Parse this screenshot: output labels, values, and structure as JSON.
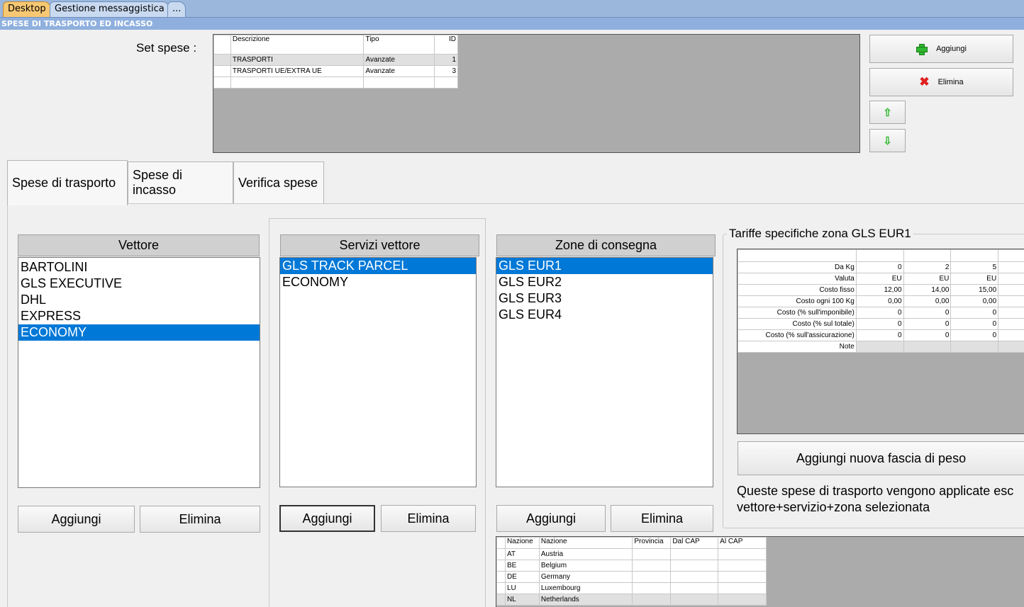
{
  "top_tabs": [
    "Desktop",
    "Gestione messaggistica",
    "..."
  ],
  "section_title": "SPESE DI TRASPORTO ED INCASSO",
  "set_spese": {
    "label": "Set spese :",
    "columns": [
      "Descrizione",
      "Tipo",
      "ID"
    ],
    "rows": [
      {
        "descrizione": "TRASPORTI",
        "tipo": "Avanzate",
        "id": "1"
      },
      {
        "descrizione": "TRASPORTI UE/EXTRA UE",
        "tipo": "Avanzate",
        "id": "3"
      }
    ],
    "add_label": "Aggiungi",
    "delete_label": "Elimina",
    "up_icon": "arrow-up-icon",
    "down_icon": "arrow-down-icon"
  },
  "tabs": [
    "Spese di trasporto",
    "Spese di incasso",
    "Verifica spese"
  ],
  "vettore": {
    "header": "Vettore",
    "items": [
      "BARTOLINI",
      "GLS EXECUTIVE",
      "DHL",
      "EXPRESS",
      "ECONOMY"
    ],
    "selected": "ECONOMY",
    "add_label": "Aggiungi",
    "delete_label": "Elimina"
  },
  "servizi": {
    "header": "Servizi vettore",
    "items": [
      "GLS TRACK PARCEL",
      "ECONOMY"
    ],
    "selected": "GLS TRACK PARCEL",
    "add_label": "Aggiungi",
    "delete_label": "Elimina"
  },
  "zone": {
    "header": "Zone di consegna",
    "items": [
      "GLS EUR1",
      "GLS EUR2",
      "GLS EUR3",
      "GLS EUR4"
    ],
    "selected": "GLS EUR1",
    "add_label": "Aggiungi",
    "delete_label": "Elimina",
    "nazioni_columns": [
      "Nazione",
      "Nazione",
      "Provincia",
      "Dal CAP",
      "Al CAP"
    ],
    "nazioni_rows": [
      [
        "AT",
        "Austria"
      ],
      [
        "BE",
        "Belgium"
      ],
      [
        "DE",
        "Germany"
      ],
      [
        "LU",
        "Luxembourg"
      ],
      [
        "NL",
        "Netherlands"
      ]
    ]
  },
  "tariffe": {
    "title": "Tariffe specifiche zona GLS EUR1",
    "row_labels": [
      "Da Kg",
      "Valuta",
      "Costo fisso",
      "Costo ogni 100 Kg",
      "Costo (% sull'imponibile)",
      "Costo (% sul totale)",
      "Costo (% sull'assicurazione)",
      "Note"
    ],
    "columns": [
      [
        "0",
        "EU",
        "12,00",
        "0,00",
        "0",
        "0",
        "0",
        ""
      ],
      [
        "2",
        "EU",
        "14,00",
        "0,00",
        "0",
        "0",
        "0",
        ""
      ],
      [
        "5",
        "EU",
        "15,00",
        "0,00",
        "0",
        "0",
        "0",
        ""
      ]
    ],
    "add_band_label": "Aggiungi nuova fascia di peso",
    "info_line1": "Queste spese di trasporto vengono applicate esc",
    "info_line2": "vettore+servizio+zona selezionata"
  }
}
